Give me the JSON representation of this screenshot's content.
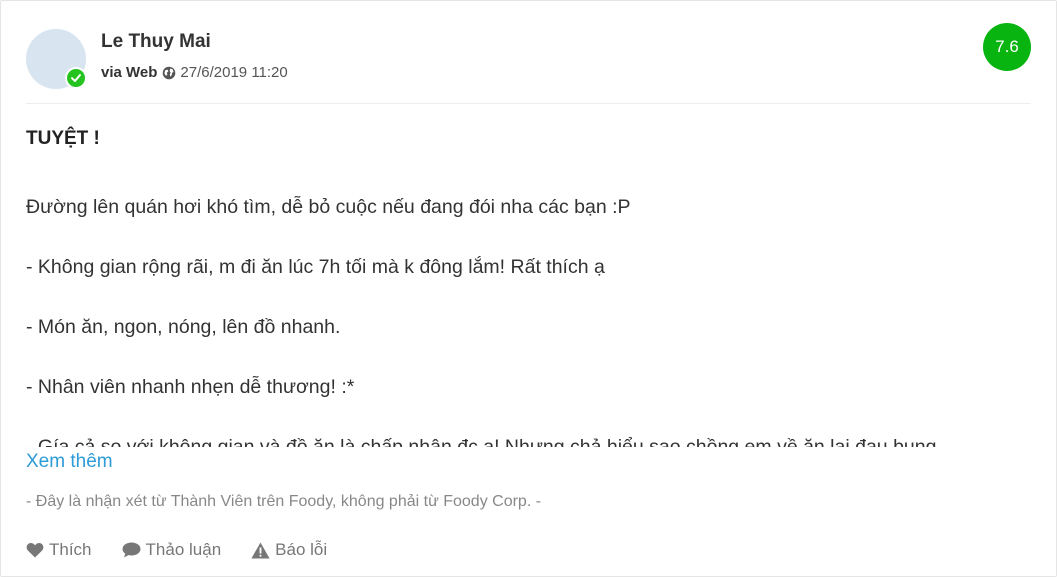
{
  "review": {
    "username": "Le Thuy Mai",
    "via": "via Web",
    "date": "27/6/2019 11:20",
    "score": "7.6",
    "title": "TUYỆT !",
    "paragraphs": [
      "Đường lên quán hơi khó tìm, dễ bỏ cuộc nếu đang đói nha các bạn :P",
      "- Không gian rộng rãi, m đi ăn lúc 7h tối mà k đông lắm! Rất thích ạ",
      "- Món ăn, ngon, nóng, lên đồ nhanh.",
      "- Nhân viên nhanh nhẹn dễ thương! :*",
      "- Gía cả so với không gian và đồ ăn là chấp nhận đc ạ! Nhưng chả hiểu sao chồng em về ăn lại đau bụng"
    ],
    "see_more": "Xem thêm",
    "disclaimer": "- Đây là nhận xét từ Thành Viên trên Foody, không phải từ Foody Corp. -"
  },
  "actions": {
    "like": "Thích",
    "discuss": "Thảo luận",
    "report": "Báo lỗi"
  },
  "colors": {
    "score_bg": "#08b40f",
    "verified": "#25c31f",
    "link": "#2d9bd8"
  }
}
